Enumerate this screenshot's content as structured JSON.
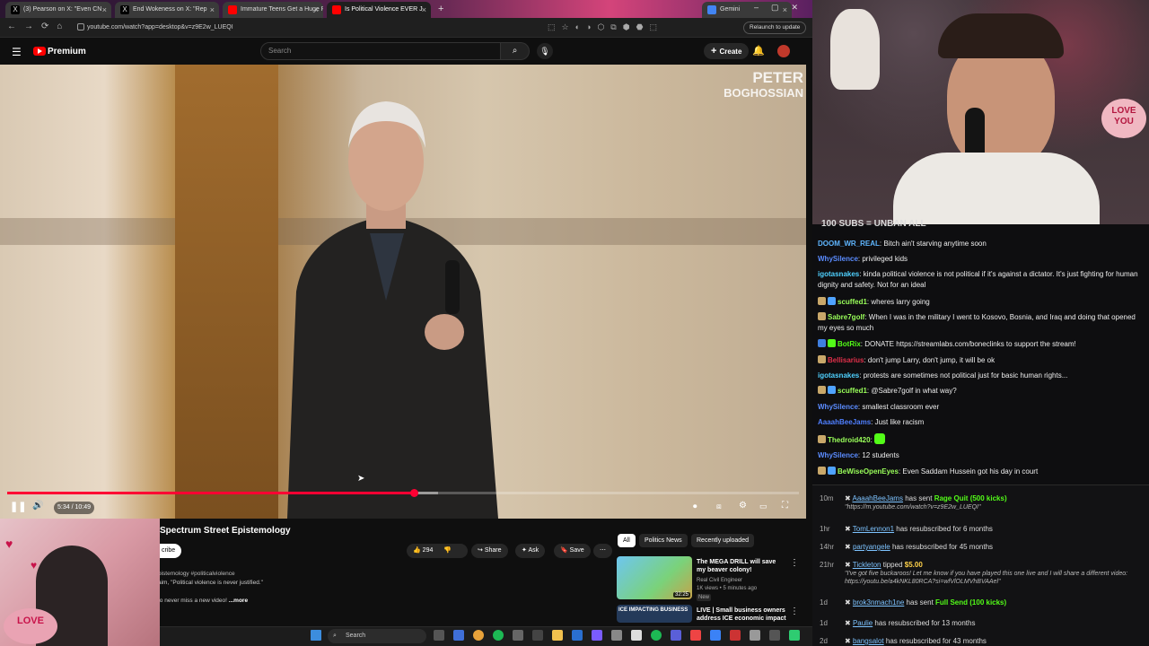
{
  "browser": {
    "tabs": [
      {
        "label": "(3) Pearson on X: \"Even CN",
        "icon": "x-logo",
        "active": false
      },
      {
        "label": "End Wokeness on X: \"Rep",
        "icon": "x-logo",
        "active": false
      },
      {
        "label": "Immature Teens Get a Huge Re",
        "icon": "youtube-logo",
        "active": false
      },
      {
        "label": "Is Political Violence EVER J",
        "icon": "youtube-logo",
        "active": true
      },
      {
        "label": "Gemini",
        "icon": "gemini-logo",
        "active": false
      }
    ],
    "url": "youtube.com/watch?app=desktop&v=z9E2w_LUEQI",
    "relaunch_label": "Relaunch to update"
  },
  "youtube": {
    "logo_label": "Premium",
    "search_placeholder": "Search",
    "create_label": "Create",
    "video": {
      "watermark_line1": "PETER",
      "watermark_line2": "BOGHOSSIAN",
      "time": "5:34 / 10:49",
      "progress": 0.514
    },
    "title": "Spectrum Street Epistemology",
    "subscribe_label": "cribe",
    "like_count": "294",
    "share_label": "Share",
    "ask_label": "Ask",
    "save_label": "Save",
    "description": {
      "line1": "pistemology #politicalviolence",
      "line2": "aim, \"Political violence is never justified.\"",
      "line3": "to never miss a new video!",
      "more_label": "...more"
    },
    "chips": [
      "All",
      "Politics News",
      "Recently uploaded"
    ],
    "recommendations": [
      {
        "title": "The MEGA DRILL will save my beaver colony!",
        "channel": "Real Civil Engineer",
        "meta": "1K views • 5 minutes ago",
        "badge": "New",
        "duration": "32:25"
      },
      {
        "title": "LIVE | Small business owners address ICE economic impact",
        "thumb_text": "ICE IMPACTING BUSINESS"
      }
    ]
  },
  "taskbar": {
    "search_label": "Search"
  },
  "stream": {
    "banner": "100 SUBS = UNBAN ALL",
    "sign_text_1": "LOVE",
    "sign_text_2": "YOU",
    "chat": [
      {
        "user": "DOOM_WR_REAL",
        "text": "Bitch ain't starving anytime soon",
        "color": "#5fb6ff",
        "badges": []
      },
      {
        "user": "WhySilence",
        "text": "privileged kids",
        "color": "#5b8cff",
        "badges": []
      },
      {
        "user": "igotasnakes",
        "text": "kinda political violence is not political if it's against a dictator. It's just fighting for human dignity and safety. Not for an ideal",
        "color": "#4fd1ff",
        "badges": []
      },
      {
        "user": "scuffed1",
        "text": "wheres larry going",
        "color": "#9aff5a",
        "badges": [
          "#c9a86a",
          "#4fa3ff"
        ]
      },
      {
        "user": "Sabre7golf",
        "text": "When I was in the military I went to Kosovo, Bosnia, and Iraq and doing that opened my eyes so much",
        "color": "#9aff5a",
        "badges": [
          "#c9a86a"
        ]
      },
      {
        "user": "BotRix",
        "text": "DONATE https://streamlabs.com/boneclinks to support the stream!",
        "color": "#53fc18",
        "badges": [
          "#3f7fe0",
          "#53fc18"
        ]
      },
      {
        "user": "Bellisarius",
        "text": "don't jump Larry, don't jump, it will be ok",
        "color": "#e0304a",
        "badges": [
          "#c9a86a"
        ]
      },
      {
        "user": "igotasnakes",
        "text": "protests are sometimes not political just for basic human rights...",
        "color": "#4fd1ff",
        "badges": []
      },
      {
        "user": "scuffed1",
        "text": "@Sabre7golf in what way?",
        "color": "#9aff5a",
        "badges": [
          "#c9a86a",
          "#4fa3ff"
        ]
      },
      {
        "user": "WhySilence",
        "text": "smallest classroom ever",
        "color": "#5b8cff",
        "badges": []
      },
      {
        "user": "AaaahBeeJams",
        "text": "Just like racism",
        "color": "#4f7fff",
        "badges": []
      },
      {
        "user": "Thedroid420",
        "text": "",
        "color": "#9aff5a",
        "badges": [
          "#c9a86a"
        ],
        "emote": true
      },
      {
        "user": "WhySilence",
        "text": "12 students",
        "color": "#5b8cff",
        "badges": []
      },
      {
        "user": "BeWiseOpenEyes",
        "text": "Even Saddam Hussein got his day in court",
        "color": "#9aff5a",
        "badges": [
          "#c9a86a",
          "#4fa3ff"
        ]
      }
    ],
    "events": [
      {
        "time": "10m",
        "user": "AaaahBeeJams",
        "action": "has sent",
        "kicks": "Rage Quit (500 kicks)",
        "note": "\"https://m.youtube.com/watch?v=z9E2w_LUEQI\""
      },
      {
        "time": "1hr",
        "user": "TomLennon1",
        "action": "has resubscribed for 6 months"
      },
      {
        "time": "14hr",
        "user": "partyangele",
        "action": "has resubscribed for 45 months"
      },
      {
        "time": "21hr",
        "user": "Tickleton",
        "action": "tipped",
        "amount": "$5.00",
        "note": "\"I've got five buckaroos! Let me know if you have played this one live and I will share a different video: https://youtu.be/a4kNKL80RCA?si=wfVlOLMVhBVAAel\""
      },
      {
        "time": "1d",
        "user": "brok3nmach1ne",
        "action": "has sent",
        "kicks": "Full Send (100 kicks)"
      },
      {
        "time": "1d",
        "user": "Paulie",
        "action": "has resubscribed for 13 months"
      },
      {
        "time": "2d",
        "user": "bangsalot",
        "action": "has resubscribed for 43 months"
      }
    ]
  }
}
